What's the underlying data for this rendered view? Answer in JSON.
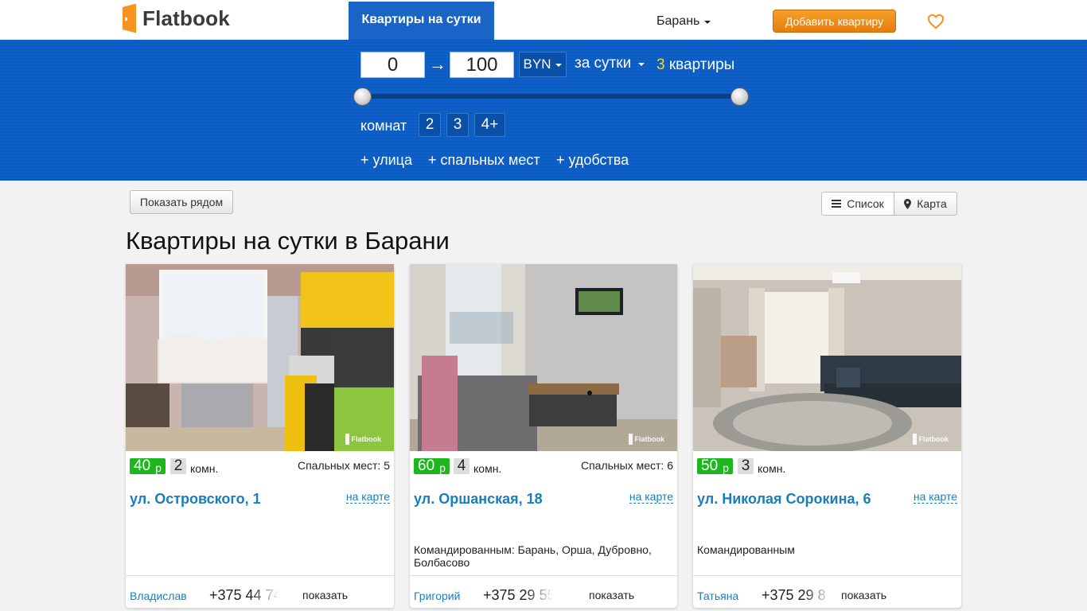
{
  "header": {
    "logo_text": "Flatbook",
    "nav_active": "Квартиры на сутки",
    "city": "Барань",
    "add_button": "Добавить квартиру",
    "favorites_icon": "heart-icon"
  },
  "filter": {
    "price_min": "0",
    "price_max": "100",
    "arrow": "→",
    "currency": "BYN",
    "period": "за сутки",
    "results_count": "3",
    "results_label": "квартиры",
    "price_range_fraction": [
      0,
      1
    ],
    "rooms_label": "комнат",
    "rooms_options": [
      "2",
      "3",
      "4+"
    ],
    "extra_street": "+ улица",
    "extra_beds": "+ спальных мест",
    "extra_amenities": "+ удобства"
  },
  "toolbar": {
    "nearby_button": "Показать рядом",
    "view_list": "Список",
    "view_map": "Карта"
  },
  "page_title": "Квартиры на сутки в Барани",
  "listings": [
    {
      "price": "40",
      "currency": "р",
      "rooms": "2",
      "rooms_suffix": "комн.",
      "beds": "Спальных мест: 5",
      "address": "ул. Островского, 1",
      "map_link": "на карте",
      "description": "",
      "owner": "Владислав",
      "phone": "+375 44 74",
      "show_label": "показать",
      "watermark": "Flatbook"
    },
    {
      "price": "60",
      "currency": "р",
      "rooms": "4",
      "rooms_suffix": "комн.",
      "beds": "Спальных мест: 6",
      "address": "ул. Оршанская, 18",
      "map_link": "на карте",
      "description": "Командированным: Барань, Орша, Дубровно, Болбасово",
      "owner": "Григорий",
      "phone": "+375 29 55",
      "show_label": "показать",
      "watermark": "Flatbook"
    },
    {
      "price": "50",
      "currency": "р",
      "rooms": "3",
      "rooms_suffix": "комн.",
      "beds": "",
      "address": "ул. Николая Сорокина, 6",
      "map_link": "на карте",
      "description": "Командированным",
      "owner": "Татьяна",
      "phone": "+375 29 8",
      "show_label": "показать",
      "watermark": "Flatbook"
    }
  ],
  "colors": {
    "brand_orange": "#f7931e",
    "filter_blue": "#0b5cc4",
    "price_green": "#1db61d",
    "link_blue": "#1a7dbd",
    "count_yellow": "#ffd42a"
  }
}
